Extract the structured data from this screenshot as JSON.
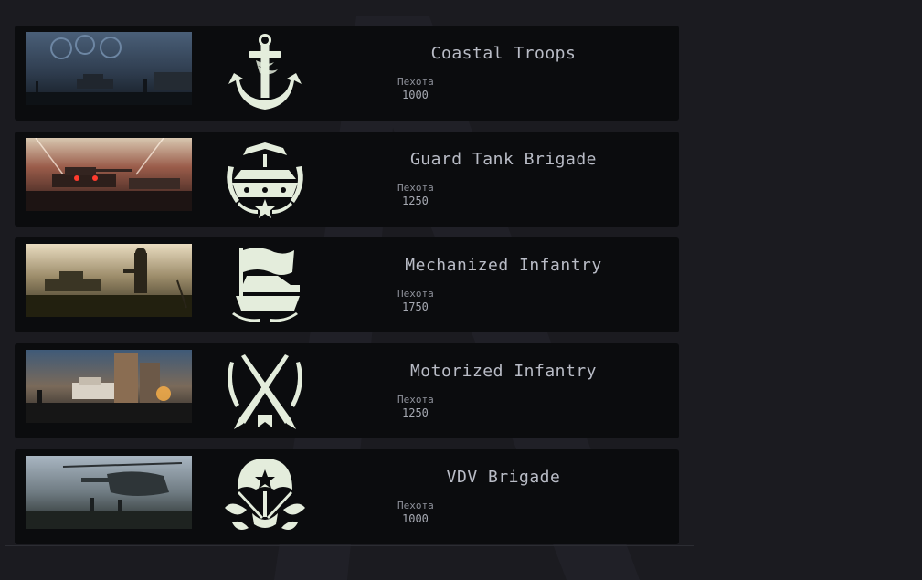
{
  "units": [
    {
      "name": "Coastal Troops",
      "stat_label": "Пехота",
      "stat_value": "1000",
      "emblem": "anchor-icon",
      "scene": "night-assault"
    },
    {
      "name": "Guard Tank Brigade",
      "stat_label": "Пехота",
      "stat_value": "1250",
      "emblem": "tank-wreath-icon",
      "scene": "tank-battle"
    },
    {
      "name": "Mechanized Infantry",
      "stat_label": "Пехота",
      "stat_value": "1750",
      "emblem": "bmp-flag-icon",
      "scene": "field-bmp"
    },
    {
      "name": "Motorized Infantry",
      "stat_label": "Пехота",
      "stat_value": "1250",
      "emblem": "crossed-rifles-icon",
      "scene": "city-fight"
    },
    {
      "name": "VDV Brigade",
      "stat_label": "Пехота",
      "stat_value": "1000",
      "emblem": "parachute-icon",
      "scene": "helicopter-landing"
    }
  ],
  "colors": {
    "page_bg": "#1b1b20",
    "card_bg": "#0b0c0e",
    "emblem": "#e4eddc",
    "title": "#b9bcc6"
  }
}
